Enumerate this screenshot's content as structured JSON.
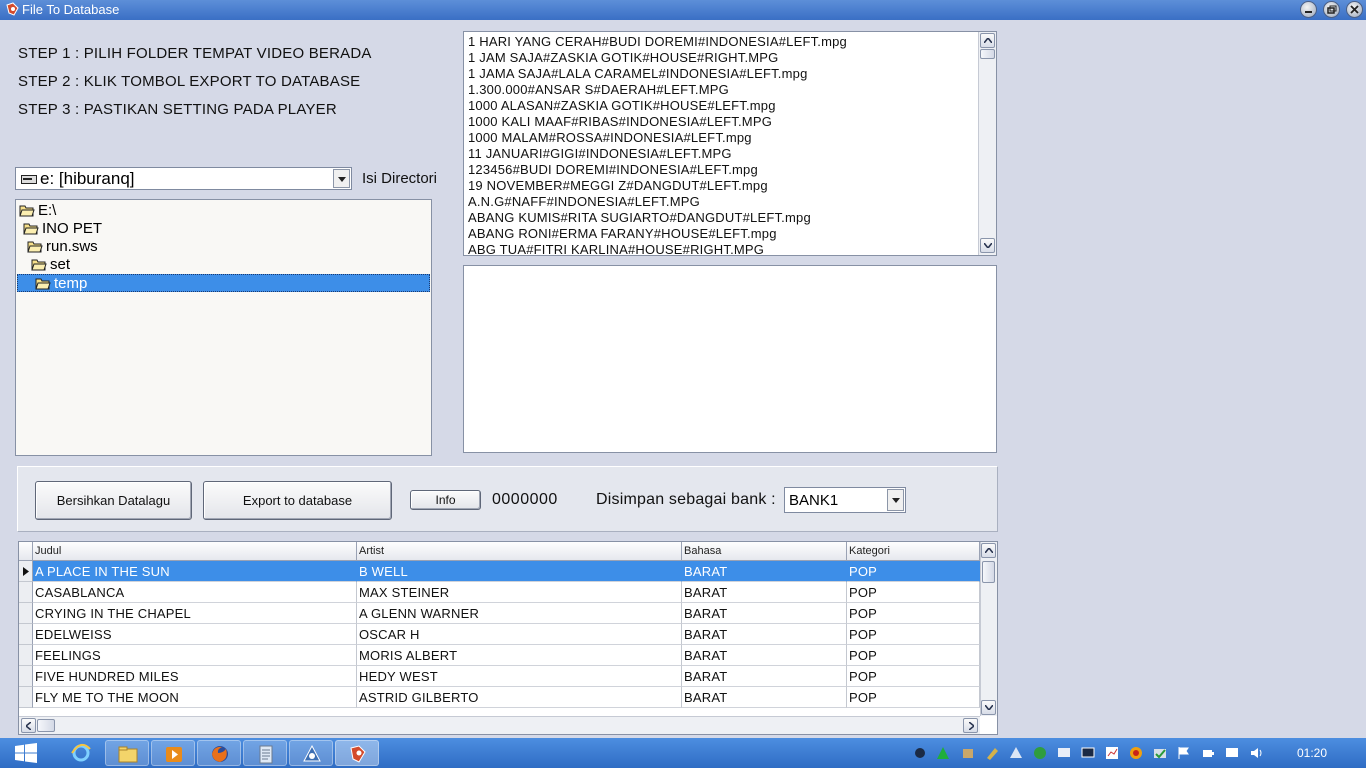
{
  "window": {
    "title": "File To Database",
    "icon": "app-icon"
  },
  "steps": [
    "STEP 1 : PILIH FOLDER TEMPAT VIDEO BERADA",
    "STEP 2 : KLIK TOMBOL EXPORT TO DATABASE",
    "STEP 3 : PASTIKAN SETTING PADA PLAYER"
  ],
  "drive": {
    "value": "e: [hiburanq]",
    "label": "Isi Directori"
  },
  "folder_tree": [
    {
      "label": "E:\\",
      "selected": false
    },
    {
      "label": "INO PET",
      "selected": false
    },
    {
      "label": "run.sws",
      "selected": false
    },
    {
      "label": "set",
      "selected": false
    },
    {
      "label": "temp",
      "selected": true
    }
  ],
  "file_list": [
    "1 HARI YANG CERAH#BUDI DOREMI#INDONESIA#LEFT.mpg",
    "1 JAM SAJA#ZASKIA GOTIK#HOUSE#RIGHT.MPG",
    "1 JAMA SAJA#LALA CARAMEL#INDONESIA#LEFT.mpg",
    "1.300.000#ANSAR S#DAERAH#LEFT.MPG",
    "1000 ALASAN#ZASKIA GOTIK#HOUSE#LEFT.mpg",
    "1000 KALI MAAF#RIBAS#INDONESIA#LEFT.MPG",
    "1000 MALAM#ROSSA#INDONESIA#LEFT.mpg",
    "11 JANUARI#GIGI#INDONESIA#LEFT.MPG",
    "123456#BUDI DOREMI#INDONESIA#LEFT.mpg",
    "19 NOVEMBER#MEGGI Z#DANGDUT#LEFT.mpg",
    "A.N.G#NAFF#INDONESIA#LEFT.MPG",
    "ABANG KUMIS#RITA SUGIARTO#DANGDUT#LEFT.mpg",
    "ABANG RONI#ERMA FARANY#HOUSE#LEFT.mpg",
    "ABG TUA#FITRI KARLINA#HOUSE#RIGHT.MPG"
  ],
  "panel": {
    "clear_label": "Bersihkan Datalagu",
    "export_label": "Export to database",
    "info_label": "Info",
    "counter": "0000000",
    "bank_label": "Disimpan sebagai bank  :",
    "bank_value": "BANK1"
  },
  "grid": {
    "columns": [
      "Judul",
      "Artist",
      "Bahasa",
      "Kategori"
    ],
    "rows": [
      {
        "cells": [
          "A PLACE IN THE SUN",
          "B WELL",
          "BARAT",
          "POP"
        ],
        "selected": true
      },
      {
        "cells": [
          "CASABLANCA",
          "MAX STEINER",
          "BARAT",
          "POP"
        ],
        "selected": false
      },
      {
        "cells": [
          "CRYING IN THE CHAPEL",
          "A GLENN WARNER",
          "BARAT",
          "POP"
        ],
        "selected": false
      },
      {
        "cells": [
          "EDELWEISS",
          "OSCAR H",
          "BARAT",
          "POP"
        ],
        "selected": false
      },
      {
        "cells": [
          "FEELINGS",
          "MORIS ALBERT",
          "BARAT",
          "POP"
        ],
        "selected": false
      },
      {
        "cells": [
          "FIVE HUNDRED MILES",
          "HEDY WEST",
          "BARAT",
          "POP"
        ],
        "selected": false
      },
      {
        "cells": [
          "FLY ME TO THE MOON",
          "ASTRID GILBERTO",
          "BARAT",
          "POP"
        ],
        "selected": false
      }
    ]
  },
  "taskbar": {
    "clock": "01:20",
    "apps": [
      "internet-explorer-icon",
      "file-explorer-icon",
      "media-player-icon",
      "firefox-icon",
      "notepad-icon",
      "app-icon-2",
      "file-to-database-icon"
    ]
  },
  "colors": {
    "selection": "#3d8ee8",
    "window_bg": "#d5d9e7",
    "titlebar": "#3a6fc5",
    "taskbar": "#3b78cf"
  }
}
